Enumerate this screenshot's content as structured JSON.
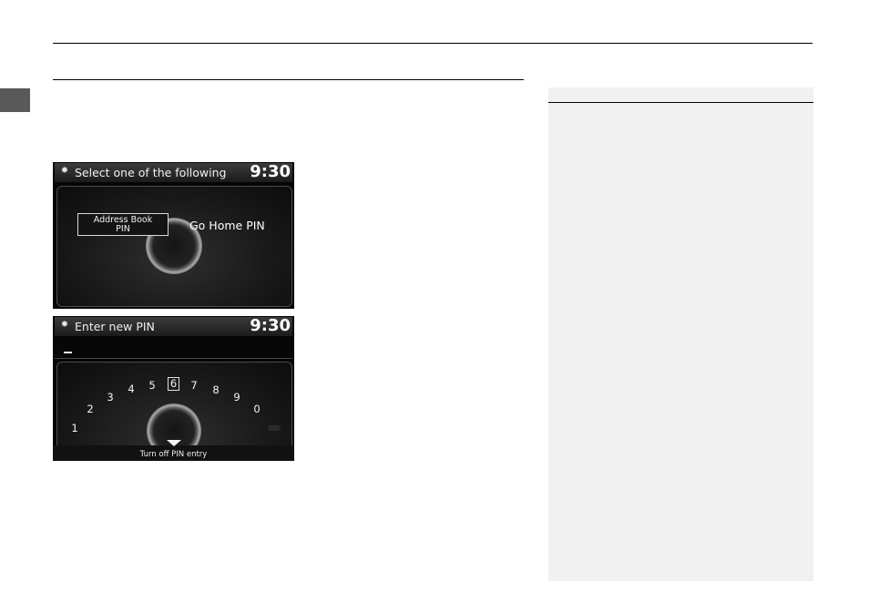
{
  "screen1": {
    "title": "Select one of the following",
    "clock": "9:30",
    "options": {
      "address_book_line1": "Address Book",
      "address_book_line2": "PIN",
      "go_home": "Go Home PIN"
    }
  },
  "screen2": {
    "title": "Enter new PIN",
    "clock": "9:30",
    "digits": [
      "1",
      "2",
      "3",
      "4",
      "5",
      "6",
      "7",
      "8",
      "9",
      "0"
    ],
    "selected_digit": "6",
    "turn_off": "Turn off PIN entry"
  }
}
